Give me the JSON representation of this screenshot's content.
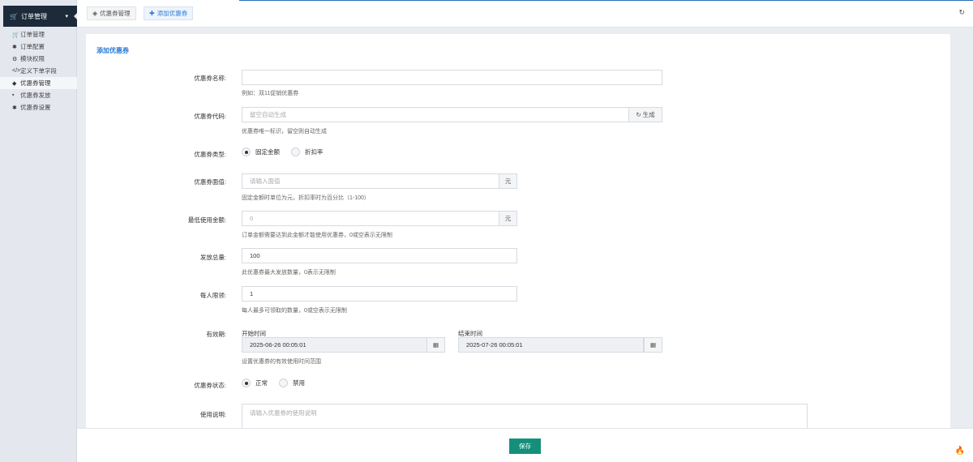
{
  "sidebar": {
    "header": {
      "icon": "cart-icon",
      "label": "订单管理"
    },
    "items": [
      {
        "icon": "cart-icon",
        "glyph": "🛒",
        "label": "订单管理"
      },
      {
        "icon": "gear-icon",
        "glyph": "✱",
        "label": "订单配置"
      },
      {
        "icon": "cogs-icon",
        "glyph": "⚙",
        "label": "模块权限"
      },
      {
        "icon": "code-icon",
        "glyph": "</>",
        "label": "定义下单字段"
      },
      {
        "icon": "ticket-icon",
        "glyph": "◆",
        "label": "优惠券管理"
      },
      {
        "icon": "gift-icon",
        "glyph": "▪",
        "label": "优惠券发放"
      },
      {
        "icon": "gear-icon",
        "glyph": "✱",
        "label": "优惠券设置"
      }
    ]
  },
  "tabs": [
    {
      "icon": "ticket-icon",
      "label": "优惠券管理"
    },
    {
      "icon": "plus-icon",
      "label": "添加优惠券"
    }
  ],
  "form": {
    "title": "添加优惠券",
    "name": {
      "label": "优惠券名称:",
      "value": "",
      "help": "例如：双11促销优惠券"
    },
    "code": {
      "label": "优惠券代码:",
      "placeholder": "留空自动生成",
      "button": "生成",
      "help": "优惠券唯一标识，留空则自动生成"
    },
    "type": {
      "label": "优惠券类型:",
      "options": [
        "固定金额",
        "折扣率"
      ],
      "selected": 0
    },
    "face_value": {
      "label": "优惠券面值:",
      "placeholder": "请输入面值",
      "unit": "元",
      "help": "固定金额时单位为元，折扣率时为百分比（1-100）"
    },
    "min_amount": {
      "label": "最低使用金额:",
      "placeholder": "0",
      "unit": "元",
      "help": "订单金额需要达到此金额才能使用优惠券，0或空表示无限制"
    },
    "total": {
      "label": "发放总量:",
      "value": "100",
      "help": "此优惠券最大发放数量，0表示无限制"
    },
    "per_user": {
      "label": "每人限领:",
      "value": "1",
      "help": "每人最多可领取的数量，0或空表示无限制"
    },
    "validity": {
      "label": "有效期:",
      "start_label": "开始时间",
      "start_value": "2025-06-26 00:05:01",
      "end_label": "结束时间",
      "end_value": "2025-07-26 00:05:01",
      "help": "设置优惠券的有效使用时间范围"
    },
    "status": {
      "label": "优惠券状态:",
      "options": [
        "正常",
        "禁用"
      ],
      "selected": 0
    },
    "description": {
      "label": "使用说明:",
      "placeholder": "请输入优惠券的使用说明"
    }
  },
  "footer": {
    "save_label": "保存"
  }
}
